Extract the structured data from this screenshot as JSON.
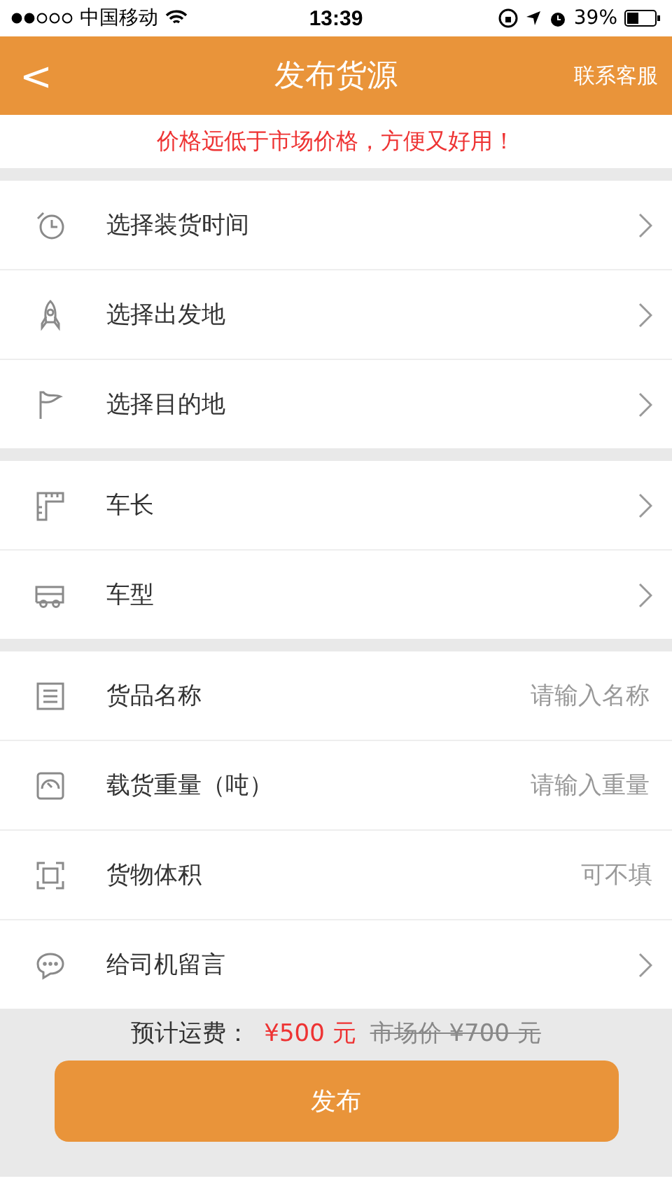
{
  "status_bar": {
    "carrier": "中国移动",
    "time": "13:39",
    "battery": "39%"
  },
  "header": {
    "back": "<",
    "title": "发布货源",
    "action": "联系客服"
  },
  "banner": "价格远低于市场价格，方便又好用！",
  "groups": [
    {
      "rows": [
        {
          "label": "选择装货时间",
          "kind": "select"
        },
        {
          "label": "选择出发地",
          "kind": "select"
        },
        {
          "label": "选择目的地",
          "kind": "select"
        }
      ]
    },
    {
      "rows": [
        {
          "label": "车长",
          "kind": "select"
        },
        {
          "label": "车型",
          "kind": "select"
        }
      ]
    },
    {
      "rows": [
        {
          "label": "货品名称",
          "kind": "input",
          "placeholder": "请输入名称"
        },
        {
          "label": "载货重量（吨）",
          "kind": "input",
          "placeholder": "请输入重量"
        },
        {
          "label": "货物体积",
          "kind": "note",
          "note": "可不填"
        },
        {
          "label": "给司机留言",
          "kind": "select"
        }
      ]
    }
  ],
  "footer": {
    "estimate_label": "预计运费：",
    "estimate": "¥500 元",
    "market_price": "市场价 ¥700 元",
    "submit": "发布"
  }
}
